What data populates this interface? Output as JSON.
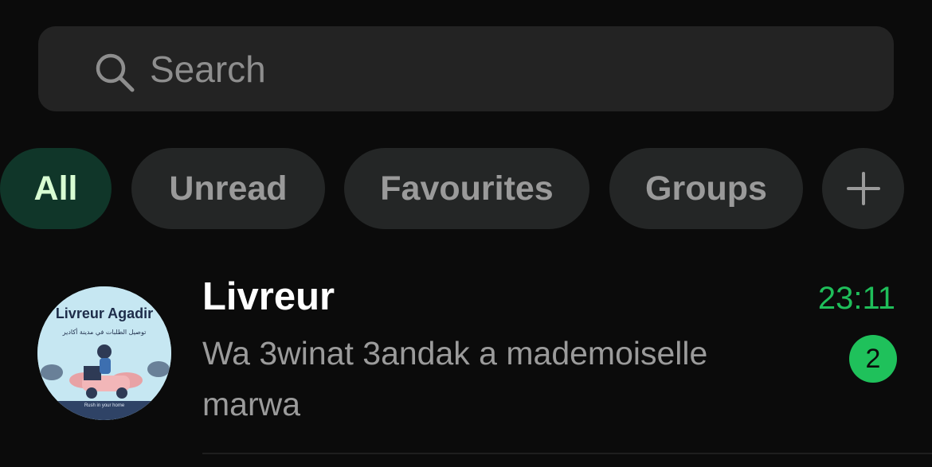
{
  "search": {
    "placeholder": "Search",
    "icon": "search-icon"
  },
  "filters": [
    {
      "label": "All",
      "active": true
    },
    {
      "label": "Unread",
      "active": false
    },
    {
      "label": "Favourites",
      "active": false
    },
    {
      "label": "Groups",
      "active": false
    }
  ],
  "add_filter": {
    "icon": "plus-icon"
  },
  "chats": [
    {
      "name": "Livreur",
      "preview": "Wa 3winat 3andak a mademoiselle marwa",
      "time": "23:11",
      "unread_count": "2",
      "avatar": {
        "title": "Livreur Agadir",
        "subtitle": "توصيل الطلبات في مدينة أكادير",
        "footer": "Rush in your home"
      }
    }
  ],
  "colors": {
    "background": "#0b0b0b",
    "accent": "#1fbe5a",
    "chip": "#242626",
    "chip_active": "#103629"
  }
}
